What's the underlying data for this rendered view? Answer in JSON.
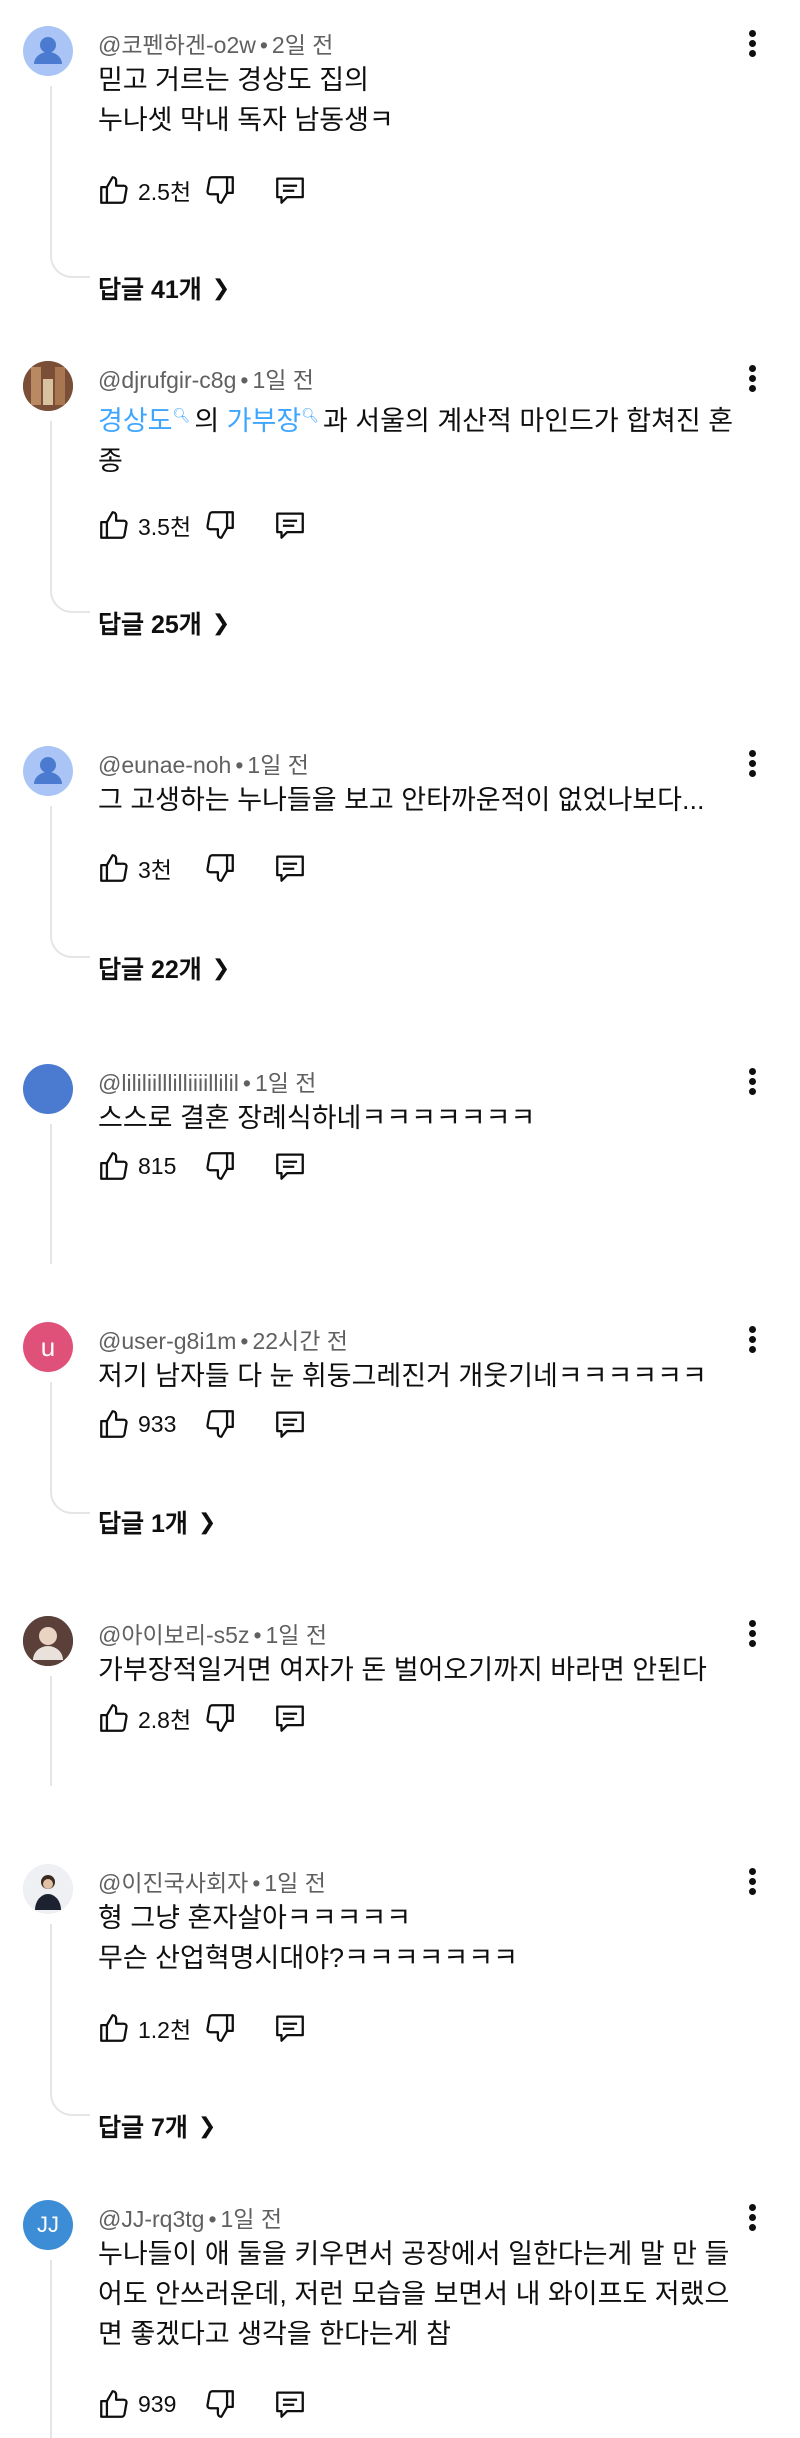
{
  "comments": [
    {
      "author": "@코펜하겐-o2w",
      "time": "2일 전",
      "lines": [
        "믿고 거르는 경상도 집의",
        "누나셋 막내 독자 남동생ㅋ"
      ],
      "likes": "2.5천",
      "replies": "답글 41개"
    },
    {
      "author": "@djrufgir-c8g",
      "time": "1일 전",
      "link1": "경상도",
      "mid": "의 ",
      "link2": "가부장",
      "rest": "과 서울의 계산적 마인드가 합쳐진 혼",
      "line2": "종",
      "likes": "3.5천",
      "replies": "답글 25개"
    },
    {
      "author": "@eunae-noh",
      "time": "1일 전",
      "lines": [
        "그 고생하는 누나들을 보고 안타까운적이 없었나보다..."
      ],
      "likes": "3천",
      "replies": "답글 22개"
    },
    {
      "author": "@lililiilllilliiiillilil",
      "time": "1일 전",
      "lines": [
        "스스로 결혼 장례식하네ㅋㅋㅋㅋㅋㅋㅋ"
      ],
      "likes": "815"
    },
    {
      "author": "@user-g8i1m",
      "time": "22시간 전",
      "avatar_letter": "u",
      "lines": [
        "저기 남자들 다 눈 휘둥그레진거 개웃기네ㅋㅋㅋㅋㅋㅋ"
      ],
      "likes": "933",
      "replies": "답글 1개"
    },
    {
      "author": "@아이보리-s5z",
      "time": "1일 전",
      "lines": [
        "가부장적일거면 여자가 돈 벌어오기까지 바라면 안된다"
      ],
      "likes": "2.8천"
    },
    {
      "author": "@이진국사회자",
      "time": "1일 전",
      "lines": [
        "형 그냥 혼자살아ㅋㅋㅋㅋㅋ",
        "무슨 산업혁명시대야?ㅋㅋㅋㅋㅋㅋㅋ"
      ],
      "likes": "1.2천",
      "replies": "답글 7개"
    },
    {
      "author": "@JJ-rq3tg",
      "time": "1일 전",
      "avatar_letter": "JJ",
      "lines": [
        "누나들이 애 둘을 키우면서 공장에서 일한다는게 말 만 들",
        "어도 안쓰러운데, 저런 모습을 보면서 내 와이프도 저랬으",
        "면 좋겠다고 생각을 한다는게 참"
      ],
      "likes": "939"
    }
  ],
  "ui": {
    "dot": "•",
    "chevron": "❯"
  },
  "colors": {
    "link": "#3ea6ff",
    "meta": "#606060",
    "avatar_default": "#a9c4f5",
    "avatar_blue": "#4a7bd0",
    "avatar_pink": "#e0517a",
    "avatar_jj": "#3c8dd6"
  }
}
